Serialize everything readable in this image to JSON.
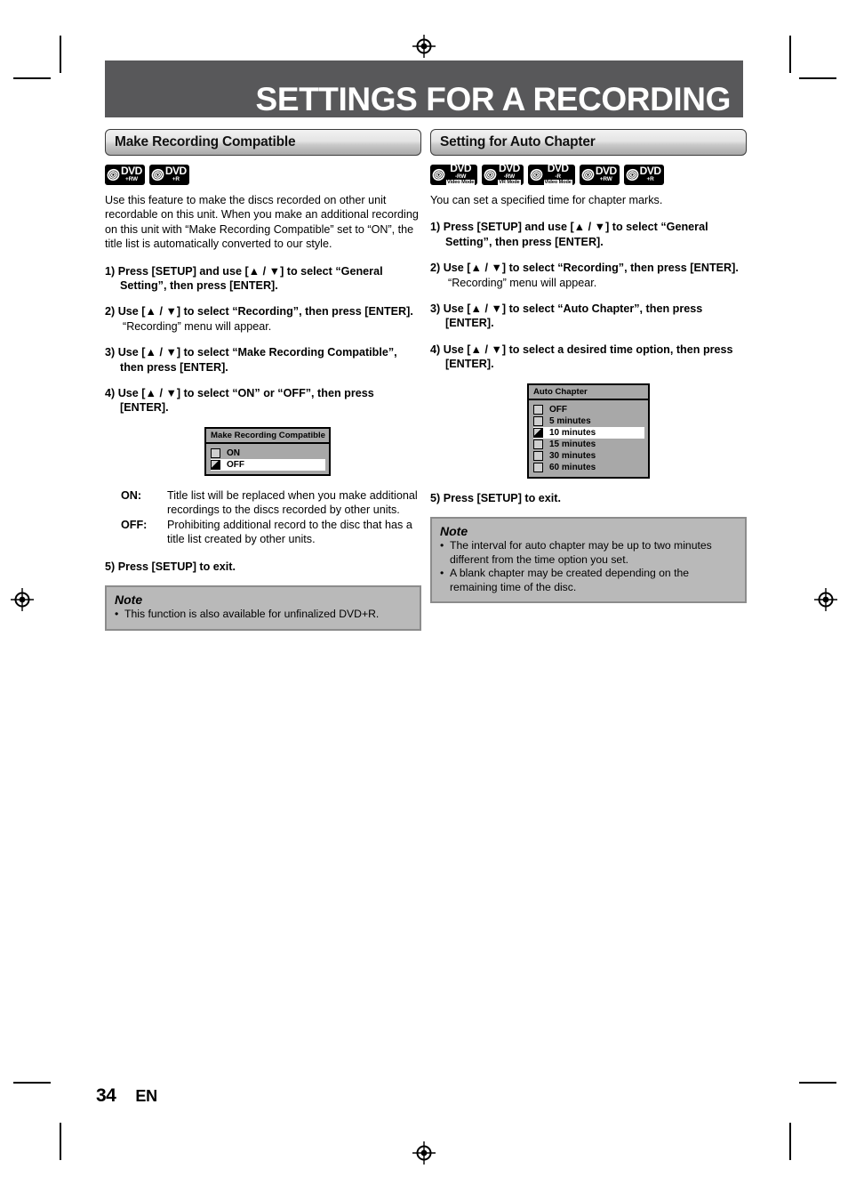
{
  "page": {
    "banner_title": "SETTINGS FOR A RECORDING",
    "number": "34",
    "language": "EN",
    "banner_color": "#58585a"
  },
  "left_column": {
    "section_title": "Make Recording Compatible",
    "badges": [
      {
        "dvd": "DVD",
        "format": "+RW",
        "mode": ""
      },
      {
        "dvd": "DVD",
        "format": "+R",
        "mode": ""
      }
    ],
    "intro": "Use this feature to make the discs recorded on other unit recordable on this unit. When you make an additional recording on this unit with “Make Recording Compatible” set to “ON”, the title list is automatically converted to our style.",
    "steps": [
      {
        "text": "1) Press [SETUP] and use [▲ / ▼] to select “General Setting”, then press [ENTER].",
        "sub": ""
      },
      {
        "text": "2) Use [▲ / ▼] to select “Recording”, then press [ENTER].",
        "sub": "“Recording” menu will appear."
      },
      {
        "text": "3) Use [▲ / ▼] to select “Make Recording Compatible”, then press [ENTER].",
        "sub": ""
      },
      {
        "text": "4) Use [▲ / ▼] to select “ON” or “OFF”, then press [ENTER].",
        "sub": ""
      }
    ],
    "osd": {
      "title": "Make Recording Compatible",
      "options": [
        {
          "label": "ON",
          "checked": false,
          "selected": false
        },
        {
          "label": "OFF",
          "checked": true,
          "selected": true
        }
      ]
    },
    "definitions": [
      {
        "term": "ON:",
        "desc": "Title list will be replaced when you make additional recordings to the discs recorded by other units."
      },
      {
        "term": "OFF:",
        "desc": "Prohibiting additional record to the disc that has a title list created by other units."
      }
    ],
    "final_step": "5) Press [SETUP] to exit.",
    "note": {
      "heading": "Note",
      "items": [
        "This function is also available for unfinalized DVD+R."
      ]
    }
  },
  "right_column": {
    "section_title": "Setting for Auto Chapter",
    "badges": [
      {
        "dvd": "DVD",
        "format": "-RW",
        "mode": "Video Mode"
      },
      {
        "dvd": "DVD",
        "format": "-RW",
        "mode": "VR Mode"
      },
      {
        "dvd": "DVD",
        "format": "-R",
        "mode": "Video Mode"
      },
      {
        "dvd": "DVD",
        "format": "+RW",
        "mode": ""
      },
      {
        "dvd": "DVD",
        "format": "+R",
        "mode": ""
      }
    ],
    "intro": "You can set a specified time for chapter marks.",
    "steps": [
      {
        "text": "1) Press [SETUP] and use [▲ / ▼] to select “General Setting”, then press [ENTER].",
        "sub": ""
      },
      {
        "text": "2) Use [▲ / ▼] to select “Recording”, then press [ENTER].",
        "sub": "“Recording” menu will appear."
      },
      {
        "text": "3) Use [▲ / ▼] to select “Auto Chapter”, then press [ENTER].",
        "sub": ""
      },
      {
        "text": "4) Use [▲ / ▼] to select a desired time option, then press [ENTER].",
        "sub": ""
      }
    ],
    "osd": {
      "title": "Auto Chapter",
      "options": [
        {
          "label": "OFF",
          "checked": false,
          "selected": false
        },
        {
          "label": "5 minutes",
          "checked": false,
          "selected": false
        },
        {
          "label": "10 minutes",
          "checked": true,
          "selected": true
        },
        {
          "label": "15 minutes",
          "checked": false,
          "selected": false
        },
        {
          "label": "30 minutes",
          "checked": false,
          "selected": false
        },
        {
          "label": "60 minutes",
          "checked": false,
          "selected": false
        }
      ]
    },
    "final_step": "5) Press [SETUP] to exit.",
    "note": {
      "heading": "Note",
      "items": [
        "The interval for auto chapter may be up to two minutes different from the time option you set.",
        "A blank chapter may be created depending on the remaining time of the disc."
      ]
    }
  }
}
